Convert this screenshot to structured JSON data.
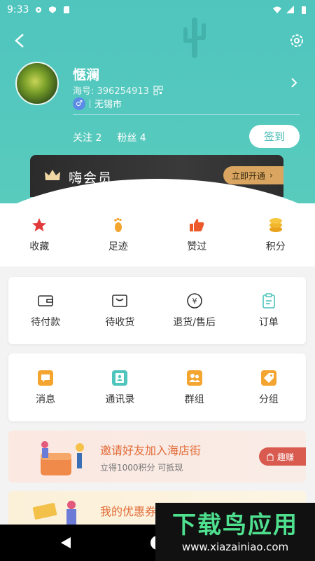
{
  "status_bar": {
    "time": "9:33"
  },
  "profile": {
    "nickname": "惬澜",
    "hai_id_label": "海号: 396254913",
    "gender_symbol": "♂",
    "city": "无锡市",
    "following": "关注 2",
    "fans": "粉丝 4",
    "checkin": "签到"
  },
  "vip": {
    "title": "嗨会员",
    "button": "立即开通"
  },
  "quick_actions": [
    {
      "label": "收藏",
      "icon": "star-icon"
    },
    {
      "label": "足迹",
      "icon": "footprint-icon"
    },
    {
      "label": "赞过",
      "icon": "thumbs-up-icon"
    },
    {
      "label": "积分",
      "icon": "coins-icon"
    }
  ],
  "orders": [
    {
      "label": "待付款",
      "icon": "wallet-icon"
    },
    {
      "label": "待收货",
      "icon": "box-icon"
    },
    {
      "label": "退货/售后",
      "icon": "refund-icon"
    },
    {
      "label": "订单",
      "icon": "clipboard-icon"
    }
  ],
  "social": [
    {
      "label": "消息",
      "icon": "chat-icon"
    },
    {
      "label": "通讯录",
      "icon": "contacts-icon"
    },
    {
      "label": "群组",
      "icon": "group-icon"
    },
    {
      "label": "分组",
      "icon": "tag-icon"
    }
  ],
  "invite": {
    "title": "邀请好友加入海店街",
    "subtitle": "立得1000积分 可抵现",
    "button": "趣赚"
  },
  "coupon": {
    "title": "我的优惠券"
  },
  "watermark": {
    "title": "下载鸟应用",
    "url": "www.xiazainiao.com"
  },
  "colors": {
    "teal": "#4fc5be",
    "accent_orange": "#e26a36",
    "vip_gold": "#d9a560"
  }
}
